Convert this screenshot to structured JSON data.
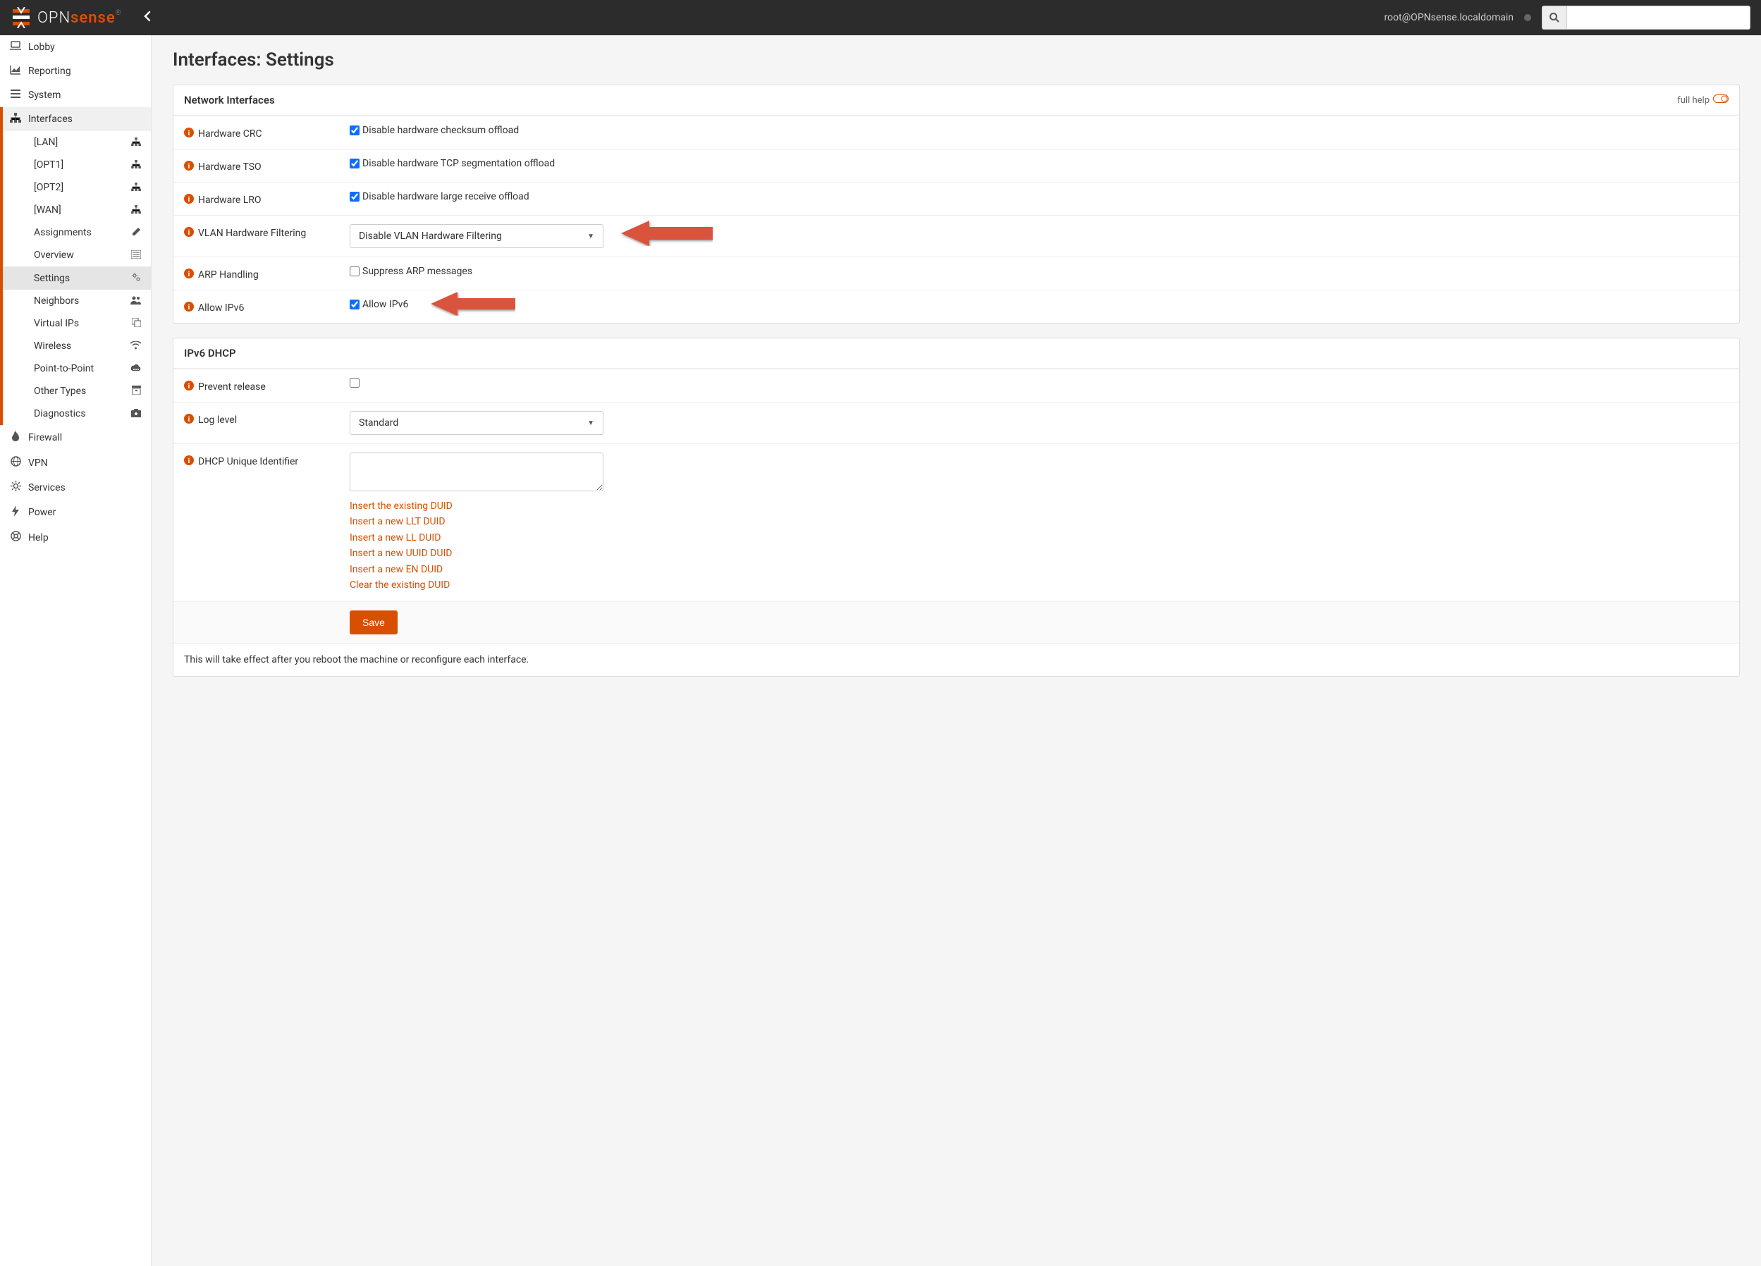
{
  "header": {
    "brand_opn": "OPN",
    "brand_sense": "sense",
    "user": "root@OPNsense.localdomain"
  },
  "sidebar": {
    "top": [
      {
        "label": "Lobby",
        "icon": "laptop"
      },
      {
        "label": "Reporting",
        "icon": "area-chart"
      },
      {
        "label": "System",
        "icon": "list"
      }
    ],
    "interfaces_label": "Interfaces",
    "interfaces_sub": [
      {
        "label": "[LAN]",
        "icon": "sitemap"
      },
      {
        "label": "[OPT1]",
        "icon": "sitemap"
      },
      {
        "label": "[OPT2]",
        "icon": "sitemap"
      },
      {
        "label": "[WAN]",
        "icon": "sitemap"
      },
      {
        "label": "Assignments",
        "icon": "pencil"
      },
      {
        "label": "Overview",
        "icon": "list-alt"
      },
      {
        "label": "Settings",
        "icon": "cogs",
        "active": true
      },
      {
        "label": "Neighbors",
        "icon": "users"
      },
      {
        "label": "Virtual IPs",
        "icon": "clone"
      },
      {
        "label": "Wireless",
        "icon": "wifi"
      },
      {
        "label": "Point-to-Point",
        "icon": "cloud"
      },
      {
        "label": "Other Types",
        "icon": "archive"
      },
      {
        "label": "Diagnostics",
        "icon": "medkit"
      }
    ],
    "bottom": [
      {
        "label": "Firewall",
        "icon": "fire"
      },
      {
        "label": "VPN",
        "icon": "globe"
      },
      {
        "label": "Services",
        "icon": "cog"
      },
      {
        "label": "Power",
        "icon": "bolt"
      },
      {
        "label": "Help",
        "icon": "life-ring"
      }
    ]
  },
  "page": {
    "title": "Interfaces: Settings",
    "section1_title": "Network Interfaces",
    "full_help": "full help",
    "rows": {
      "crc_label": "Hardware CRC",
      "crc_text": "Disable hardware checksum offload",
      "tso_label": "Hardware TSO",
      "tso_text": "Disable hardware TCP segmentation offload",
      "lro_label": "Hardware LRO",
      "lro_text": "Disable hardware large receive offload",
      "vlan_label": "VLAN Hardware Filtering",
      "vlan_select": "Disable VLAN Hardware Filtering",
      "arp_label": "ARP Handling",
      "arp_text": "Suppress ARP messages",
      "ipv6_label": "Allow IPv6",
      "ipv6_text": "Allow IPv6"
    },
    "section2_title": "IPv6 DHCP",
    "dhcp": {
      "prevent_label": "Prevent release",
      "log_label": "Log level",
      "log_select": "Standard",
      "duid_label": "DHCP Unique Identifier",
      "duid_links": [
        "Insert the existing DUID",
        "Insert a new LLT DUID",
        "Insert a new LL DUID",
        "Insert a new UUID DUID",
        "Insert a new EN DUID",
        "Clear the existing DUID"
      ]
    },
    "save": "Save",
    "footer": "This will take effect after you reboot the machine or reconfigure each interface."
  }
}
